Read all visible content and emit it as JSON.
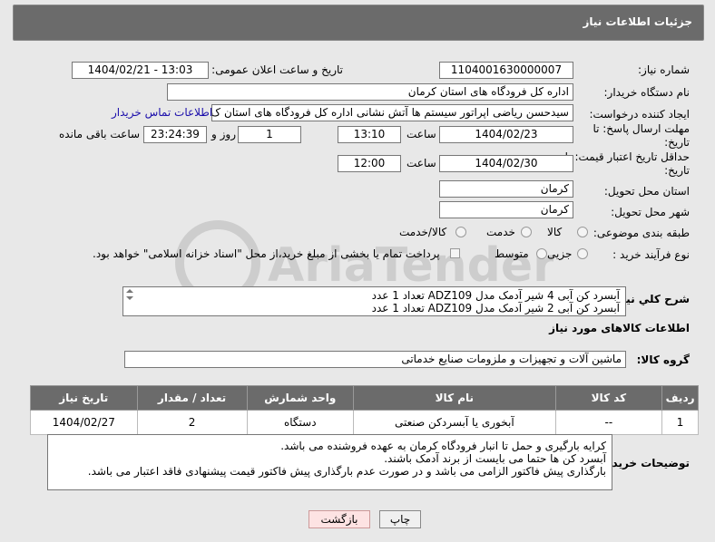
{
  "header": {
    "title": "جزئیات اطلاعات نیاز"
  },
  "form": {
    "need_number": {
      "label": "شماره نیاز:",
      "value": "1104001630000007"
    },
    "announce_datetime": {
      "label": "تاریخ و ساعت اعلان عمومی:",
      "value": "1404/02/21 - 13:03"
    },
    "buyer_org": {
      "label": "نام دستگاه خریدار:",
      "value": "اداره کل فرودگاه های استان کرمان"
    },
    "requester": {
      "label": "ایجاد کننده درخواست:",
      "value": "سیدحسن ریاضی اپراتور سیستم ها آتش نشانی اداره کل فرودگاه های استان ک",
      "contact_link": "اطلاعات تماس خریدار"
    },
    "reply_deadline": {
      "label": "مهلت ارسال پاسخ: تا تاریخ:",
      "date": "1404/02/23",
      "time_label": "ساعت",
      "time": "13:10",
      "days": "1",
      "days_label": "روز و",
      "remaining": "23:24:39",
      "remaining_label": "ساعت باقی مانده"
    },
    "price_validity": {
      "label": "حداقل تاریخ اعتبار قیمت: تا تاریخ:",
      "date": "1404/02/30",
      "time_label": "ساعت",
      "time": "12:00"
    },
    "delivery_province": {
      "label": "استان محل تحویل:",
      "value": "کرمان"
    },
    "delivery_city": {
      "label": "شهر محل تحویل:",
      "value": "کرمان"
    },
    "category": {
      "label": "طبقه بندی موضوعی:",
      "options": [
        "کالا",
        "خدمت",
        "کالا/خدمت"
      ]
    },
    "purchase_type": {
      "label": "نوع فرآیند خرید :",
      "options": [
        "جزیی",
        "متوسط"
      ],
      "payment_note": "پرداخت تمام یا بخشی از مبلغ خرید،از محل \"اسناد خزانه اسلامی\" خواهد بود."
    },
    "general_desc": {
      "label": "شرح کلي نياز:",
      "line1": "آبسرد کن آبی 4 شیر آدمک مدل ADZ109        تعداد 1 عدد",
      "line2": "آبسرد کن آبی 2 شیر آدمک مدل ADZ109        تعداد 1 عدد"
    }
  },
  "goods_section": {
    "title": "اطلاعات کالاهای مورد نیاز",
    "group_label": "گروه کالا:",
    "group_value": "ماشین آلات و تجهیزات و ملزومات صنایع خدماتی"
  },
  "table": {
    "headers": [
      "ردیف",
      "کد کالا",
      "نام کالا",
      "واحد شمارش",
      "تعداد / مقدار",
      "تاریخ نیاز"
    ],
    "rows": [
      {
        "index": "1",
        "code": "--",
        "name": "آبخوری یا آبسردکن صنعتی",
        "unit": "دستگاه",
        "qty": "2",
        "date": "1404/02/27"
      }
    ]
  },
  "buyer_notes": {
    "label": "توضیحات خریدار:",
    "line1": "کرایه بارگیری و حمل تا انبار فرودگاه کرمان به عهده فروشنده می باشد.",
    "line2": "آبسرد کن ها حتما می بایست از برند آدمک باشند.",
    "line3": "بارگذاری پیش فاکتور  الزامی می باشد و در صورت عدم بارگذاری پیش فاکتور قیمت پیشنهادی  فاقد اعتبار می باشد."
  },
  "buttons": {
    "print": "چاپ",
    "back": "بازگشت"
  },
  "watermark": {
    "text": "AriaTender.neT"
  }
}
